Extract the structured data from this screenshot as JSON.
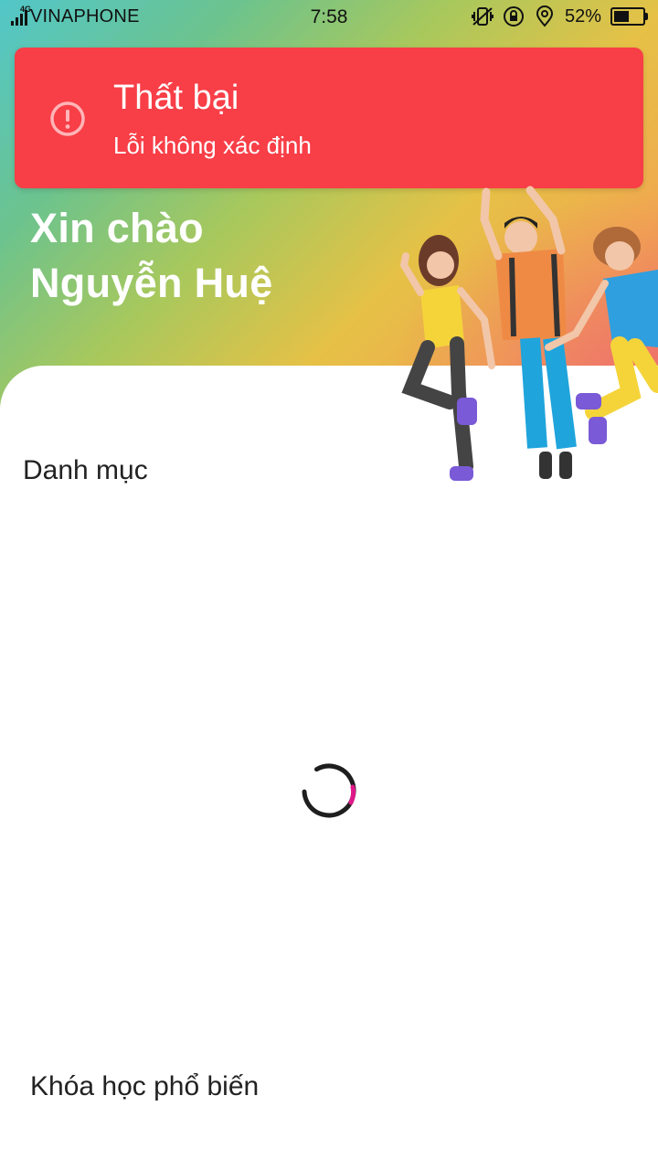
{
  "status_bar": {
    "network": "4G",
    "carrier": "VINAPHONE",
    "time": "7:58",
    "battery_percent": "52%",
    "battery_level": 0.52,
    "icons": [
      "signal-icon",
      "vibrate-icon",
      "rotation-lock-icon",
      "location-icon",
      "battery-icon"
    ]
  },
  "toast": {
    "title": "Thất bại",
    "message": "Lỗi không xác định",
    "icon": "alert-circle-icon",
    "background": "#f83e47"
  },
  "greeting": {
    "line1": "Xin chào",
    "line2": "Nguyễn Huệ"
  },
  "sections": {
    "categories_title": "Danh mục",
    "popular_title": "Khóa học phổ biến"
  },
  "loading": {
    "icon": "loading-spinner-icon",
    "accent": "#e0188a"
  },
  "colors": {
    "hero_start": "#52c7c9",
    "hero_end": "#ef7a62"
  }
}
